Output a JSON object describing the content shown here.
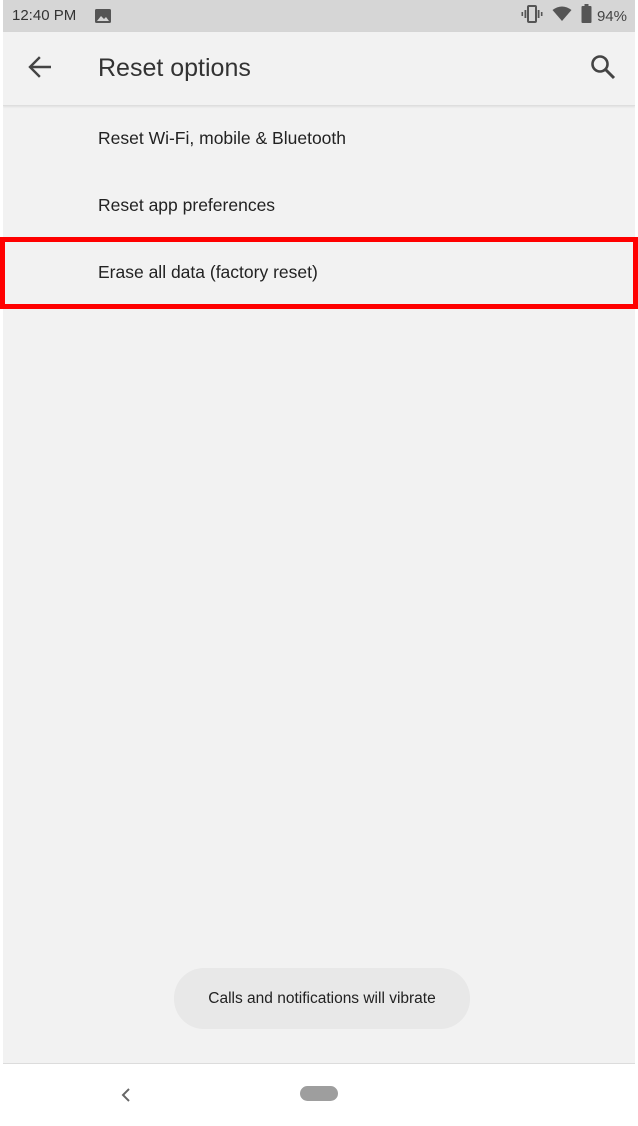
{
  "status_bar": {
    "time": "12:40 PM",
    "battery_percent": "94%",
    "icons": [
      "image-icon",
      "vibrate-icon",
      "wifi-icon",
      "battery-icon"
    ]
  },
  "app_bar": {
    "title": "Reset options",
    "back_icon": "arrow-left-icon",
    "search_icon": "search-icon"
  },
  "reset_list": {
    "items": [
      {
        "label": "Reset Wi-Fi, mobile & Bluetooth"
      },
      {
        "label": "Reset app preferences"
      },
      {
        "label": "Erase all data (factory reset)"
      }
    ],
    "highlighted_index": 2
  },
  "toast": {
    "message": "Calls and notifications will vibrate"
  },
  "nav_bar": {
    "back_icon": "chevron-left-icon",
    "home_icon": "home-pill-icon"
  },
  "colors": {
    "highlight": "#ff0000",
    "background": "#f2f2f2",
    "status_bar": "#d6d6d6"
  }
}
